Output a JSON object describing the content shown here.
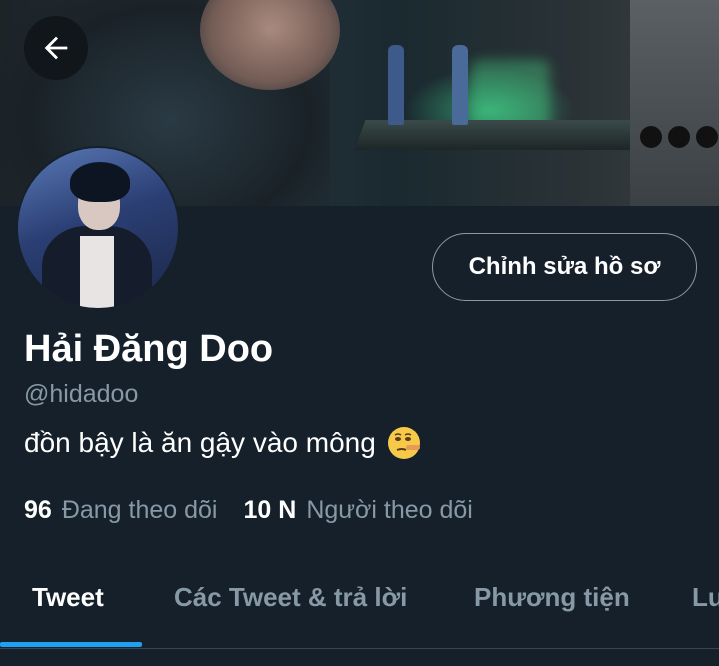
{
  "profile": {
    "name": "Hải Đăng Doo",
    "handle": "@hidadoo",
    "bio": "đồn bậy là ăn gậy vào mông",
    "bio_emoji": "lying-face-emoji"
  },
  "actions": {
    "edit_profile_label": "Chỉnh sửa hồ sơ",
    "back_icon": "arrow-left-icon"
  },
  "stats": {
    "following_count": "96",
    "following_label": "Đang theo dõi",
    "followers_count": "10 N",
    "followers_label": "Người theo dõi"
  },
  "tabs": [
    {
      "label": "Tweet",
      "active": true
    },
    {
      "label": "Các Tweet & trả lời",
      "active": false
    },
    {
      "label": "Phương tiện",
      "active": false
    },
    {
      "label": "Lu",
      "active": false
    }
  ],
  "colors": {
    "background": "#15202b",
    "accent": "#1da1f2",
    "secondary_text": "#8899a6",
    "border": "#38444d"
  }
}
